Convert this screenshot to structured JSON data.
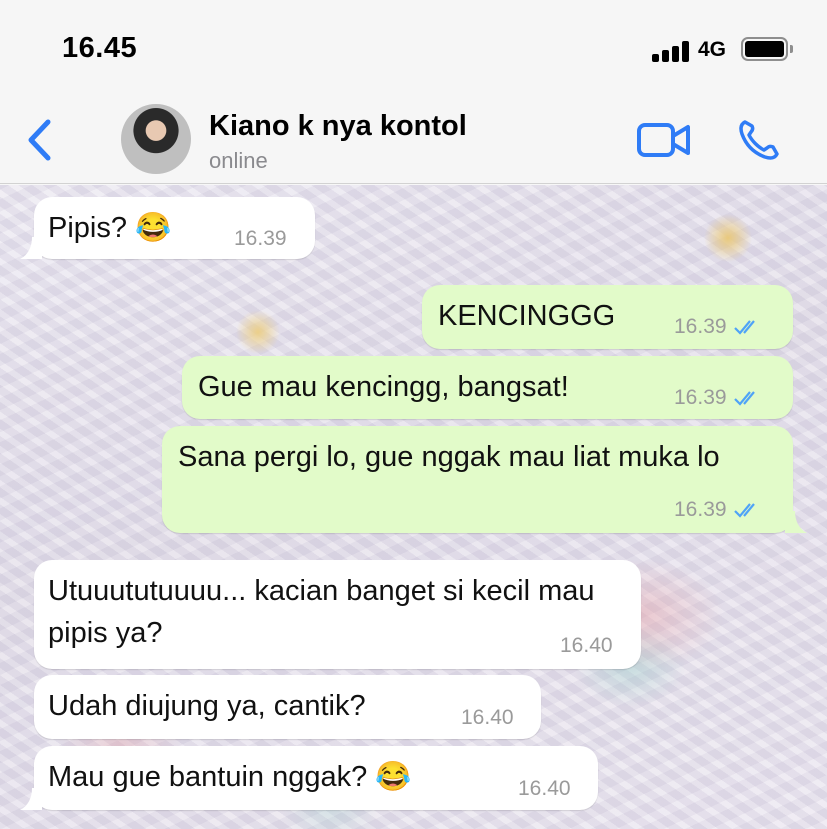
{
  "status_bar": {
    "time": "16.45",
    "network": "4G"
  },
  "header": {
    "contact_name": "Kiano k nya kontol",
    "presence": "online",
    "accent_color": "#2f7cf6"
  },
  "messages": [
    {
      "direction": "incoming",
      "text": "Pipis? 😂",
      "time": "16.39"
    },
    {
      "direction": "outgoing",
      "text": "KENCINGGG",
      "time": "16.39",
      "status": "read"
    },
    {
      "direction": "outgoing",
      "text": "Gue mau kencingg, bangsat!",
      "time": "16.39",
      "status": "read"
    },
    {
      "direction": "outgoing",
      "text": "Sana pergi lo, gue nggak mau liat muka lo",
      "time": "16.39",
      "status": "read"
    },
    {
      "direction": "incoming",
      "text": "Utuuututuuuu... kacian banget si kecil mau pipis ya?",
      "time": "16.40"
    },
    {
      "direction": "incoming",
      "text": "Udah diujung ya, cantik?",
      "time": "16.40"
    },
    {
      "direction": "incoming",
      "text": "Mau gue bantuin nggak? 😂",
      "time": "16.40"
    }
  ],
  "colors": {
    "incoming_bubble": "#ffffff",
    "outgoing_bubble": "#e2fbc9",
    "read_ticks": "#4fa3f7"
  }
}
